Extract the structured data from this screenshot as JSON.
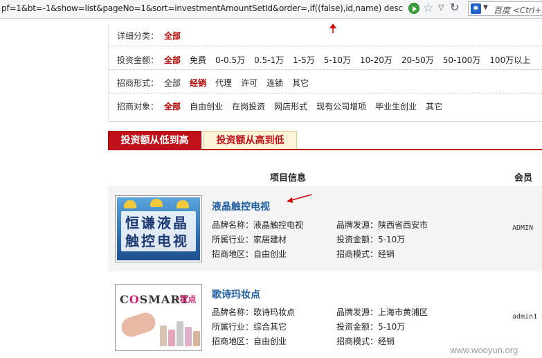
{
  "browser": {
    "url": "pf=1&bt=-1&show=list&pageNo=1&sort=investmentAmountSetId&order=,if((false),id,name) desc",
    "search_engine": "百度 <Ctrl+K>"
  },
  "filters": [
    {
      "label": "详细分类：",
      "options": [
        "全部"
      ],
      "active": "全部"
    },
    {
      "label": "投资金额：",
      "options": [
        "全部",
        "免费",
        "0-0.5万",
        "0.5-1万",
        "1-5万",
        "5-10万",
        "10-20万",
        "20-50万",
        "50-100万",
        "100万以上"
      ],
      "active": "全部"
    },
    {
      "label": "招商形式：",
      "options": [
        "全部",
        "经销",
        "代理",
        "许可",
        "连锁",
        "其它"
      ],
      "active": "经销"
    },
    {
      "label": "招商对象：",
      "options": [
        "全部",
        "自由创业",
        "在岗投资",
        "网店形式",
        "现有公司增项",
        "毕业生创业",
        "其它"
      ],
      "active": "全部"
    }
  ],
  "sort_tabs": {
    "asc": "投资额从低到高",
    "desc": "投资额从高到低"
  },
  "list_header": {
    "info": "项目信息",
    "member": "会员"
  },
  "items": [
    {
      "title": "液晶触控电视",
      "thumb_text": "恒谦液晶触控电视",
      "brand": "品牌名称：液晶触控电视",
      "origin": "品牌发源：陕西省西安市",
      "industry": "所属行业：家居建材",
      "amount": "投资金额：5-10万",
      "region": "招商地区：自由创业",
      "mode": "招商模式：经销",
      "member": "ADMIN"
    },
    {
      "title": "歌诗玛妆点",
      "thumb_text": "COSMART·妆点",
      "brand": "品牌名称：歌诗玛妆点",
      "origin": "品牌发源：上海市黄浦区",
      "industry": "所属行业：综合其它",
      "amount": "投资金额：5-10万",
      "region": "招商地区：自由创业",
      "mode": "招商模式：经销",
      "member": "admin1"
    }
  ],
  "watermark": "www.wooyun.org",
  "colors": {
    "accent": "#c0111a",
    "link": "#1f5fa0",
    "annotation": "#d40000"
  }
}
